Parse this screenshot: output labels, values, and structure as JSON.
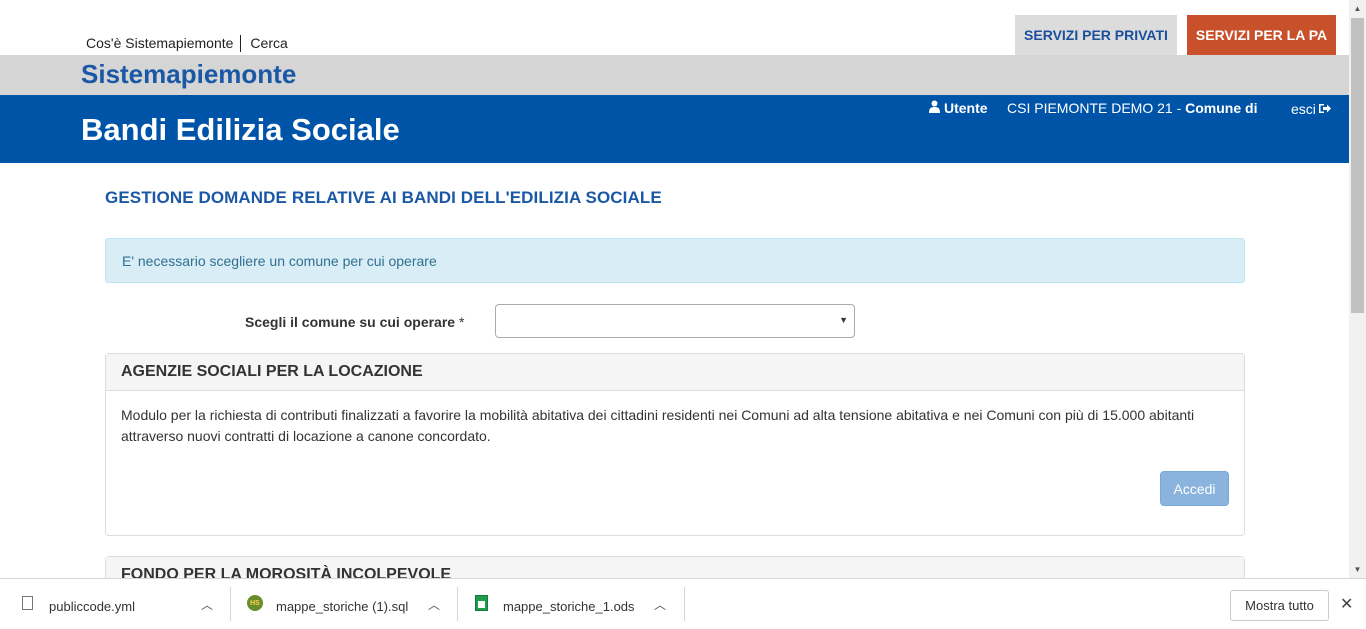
{
  "header": {
    "top_links": [
      "Cos'è Sistemapiemonte",
      "Cerca"
    ],
    "services_private": "SERVIZI PER PRIVATI",
    "services_pa": "SERVIZI PER LA PA",
    "brand": "Sistemapiemonte",
    "app_title": "Bandi Edilizia Sociale",
    "user_label": "Utente",
    "org_prefix": "CSI PIEMONTE DEMO 21 - ",
    "org_bold": "Comune di",
    "logout_label": "esci"
  },
  "main": {
    "page_title": "GESTIONE DOMANDE RELATIVE AI BANDI DELL'EDILIZIA SOCIALE",
    "alert": "E' necessario scegliere un comune per cui operare",
    "select_label": "Scegli il comune su cui operare",
    "select_required": "*",
    "select_value": "",
    "panels": [
      {
        "title": "AGENZIE SOCIALI PER LA LOCAZIONE",
        "body": "Modulo per la richiesta di contributi finalizzati a favorire la mobilità abitativa dei cittadini residenti nei Comuni ad alta tensione abitativa e nei Comuni con più di 15.000 abitanti attraverso nuovi contratti di locazione a canone concordato.",
        "button": "Accedi"
      },
      {
        "title": "FONDO PER LA MOROSITÀ INCOLPEVOLE"
      }
    ]
  },
  "downloads": {
    "items": [
      {
        "name": "publiccode.yml",
        "icon": "file-icon"
      },
      {
        "name": "mappe_storiche (1).sql",
        "icon": "sql-file-icon"
      },
      {
        "name": "mappe_storiche_1.ods",
        "icon": "spreadsheet-icon"
      }
    ],
    "show_all": "Mostra tutto"
  },
  "colors": {
    "brand_blue": "#0054a8",
    "pa_orange": "#c8512b",
    "alert_bg": "#d9edf7"
  }
}
